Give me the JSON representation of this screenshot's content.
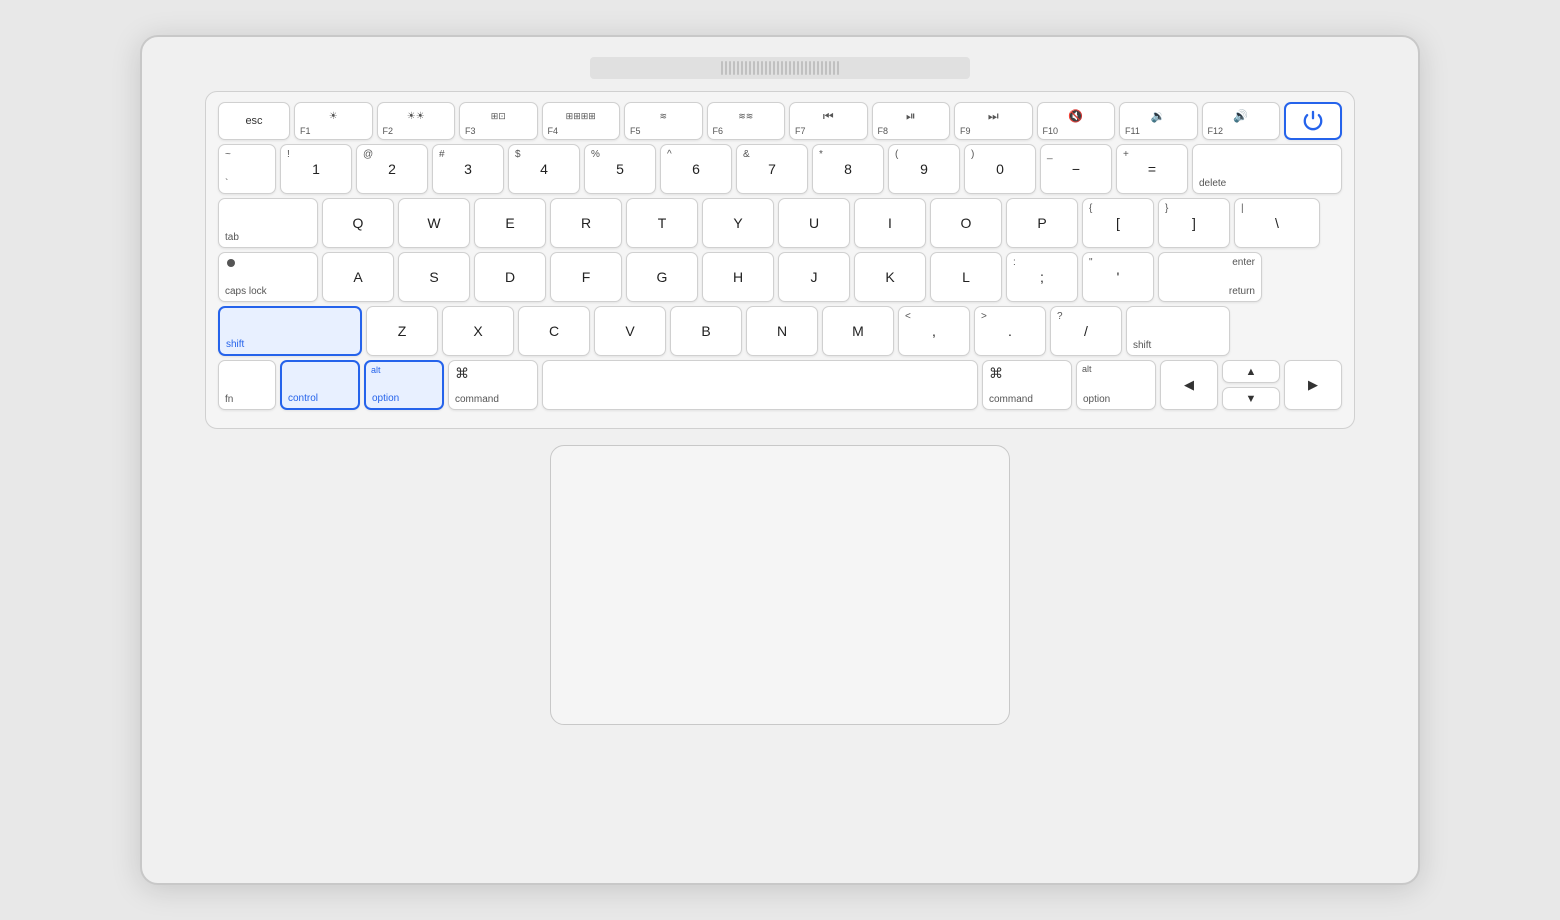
{
  "keyboard": {
    "fn_row": {
      "esc": "esc",
      "f1": {
        "icon": "☀",
        "label": "F1"
      },
      "f2": {
        "icon": "☀☀",
        "label": "F2"
      },
      "f3": {
        "icon": "⊞",
        "label": "F3"
      },
      "f4": {
        "icon": "⊞⊞",
        "label": "F4"
      },
      "f5": {
        "icon": "≋",
        "label": "F5"
      },
      "f6": {
        "icon": "≋≋",
        "label": "F6"
      },
      "f7": {
        "icon": "⏮",
        "label": "F7"
      },
      "f8": {
        "icon": "⏯",
        "label": "F8"
      },
      "f9": {
        "icon": "⏭",
        "label": "F9"
      },
      "f10": {
        "icon": "🔇",
        "label": "F10"
      },
      "f11": {
        "icon": "🔉",
        "label": "F11"
      },
      "f12": {
        "icon": "🔊",
        "label": "F12"
      },
      "power": "⏻"
    },
    "row1": {
      "backtick": {
        "top": "~",
        "bottom": "`"
      },
      "1": {
        "top": "!",
        "bottom": "1"
      },
      "2": {
        "top": "@",
        "bottom": "2"
      },
      "3": {
        "top": "#",
        "bottom": "3"
      },
      "4": {
        "top": "$",
        "bottom": "4"
      },
      "5": {
        "top": "%",
        "bottom": "5"
      },
      "6": {
        "top": "^",
        "bottom": "6"
      },
      "7": {
        "top": "&",
        "bottom": "7"
      },
      "8": {
        "top": "*",
        "bottom": "8"
      },
      "9": {
        "top": "(",
        "bottom": "9"
      },
      "0": {
        "top": ")",
        "bottom": "0"
      },
      "minus": {
        "top": "_",
        "bottom": "−"
      },
      "equals": {
        "top": "+",
        "bottom": "="
      },
      "delete": "delete"
    },
    "row2": {
      "tab": "tab",
      "q": "Q",
      "w": "W",
      "e": "E",
      "r": "R",
      "t": "T",
      "y": "Y",
      "u": "U",
      "i": "I",
      "o": "O",
      "p": "P",
      "bracket_l": {
        "top": "{",
        "bottom": "["
      },
      "bracket_r": {
        "top": "}",
        "bottom": "]"
      },
      "backslash": {
        "top": "|",
        "bottom": "\\"
      }
    },
    "row3": {
      "capslock": "caps lock",
      "a": "A",
      "s": "S",
      "d": "D",
      "f": "F",
      "g": "G",
      "h": "H",
      "j": "J",
      "k": "K",
      "l": "L",
      "semicolon": {
        "top": ":",
        "bottom": ";"
      },
      "quote": {
        "top": "\"",
        "bottom": "'"
      },
      "enter_top": "enter",
      "enter_bottom": "return"
    },
    "row4": {
      "shift_l": "shift",
      "z": "Z",
      "x": "X",
      "c": "C",
      "v": "V",
      "b": "B",
      "n": "N",
      "m": "M",
      "comma": {
        "top": "<",
        "bottom": ","
      },
      "period": {
        "top": ">",
        "bottom": "."
      },
      "slash": {
        "top": "?",
        "bottom": "/"
      },
      "shift_r": "shift"
    },
    "row5": {
      "fn": "fn",
      "control": "control",
      "option_l_alt": "alt",
      "option_l": "option",
      "command_l_icon": "⌘",
      "command_l": "command",
      "space": "",
      "command_r_icon": "⌘",
      "command_r": "command",
      "option_r_alt": "alt",
      "option_r": "option",
      "arrow_left": "◀",
      "arrow_up": "▲",
      "arrow_down": "▼",
      "arrow_right": "▶"
    }
  }
}
